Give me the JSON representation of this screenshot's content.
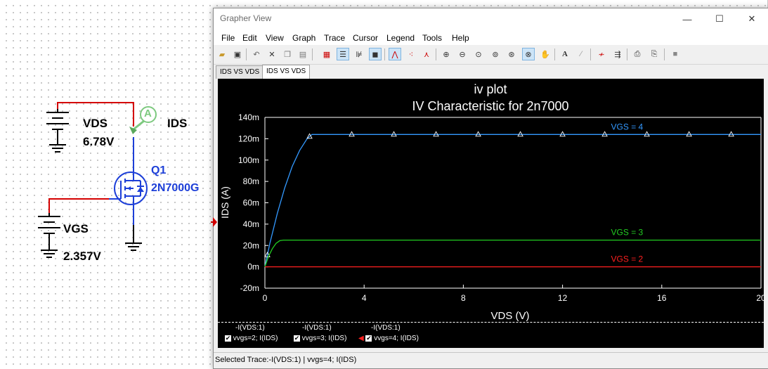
{
  "schematic": {
    "vds": {
      "name": "VDS",
      "value": "6.78V"
    },
    "vgs": {
      "name": "VGS",
      "value": "2.357V"
    },
    "ammeter": {
      "symbol": "A",
      "label": "IDS"
    },
    "transistor": {
      "ref": "Q1",
      "part": "2N7000G"
    },
    "colors": {
      "wire": "#d40000",
      "part": "#1d3fd8",
      "probe": "#7dc97f"
    }
  },
  "window": {
    "title": "Grapher View",
    "controls": {
      "minimize": "—",
      "maximize": "☐",
      "close": "✕"
    }
  },
  "menu": [
    "File",
    "Edit",
    "View",
    "Graph",
    "Trace",
    "Cursor",
    "Legend",
    "Tools",
    "Help"
  ],
  "toolbar_icons": [
    "open-icon",
    "save-icon",
    "undo-icon",
    "cut-icon",
    "copy-icon",
    "paste-icon",
    "grid-icon",
    "legend-icon",
    "bode-icon",
    "reverse-colors-icon",
    "cursor-icon",
    "data-point-icon",
    "data-marker-icon",
    "zoom-in-icon",
    "zoom-out-icon",
    "zoom-area-icon",
    "zoom-x-icon",
    "zoom-y-icon",
    "zoom-full-icon",
    "pan-icon",
    "text-icon",
    "format-icon",
    "overlay-icon",
    "export-icon",
    "print-icon",
    "print-preview-icon",
    "stop-icon"
  ],
  "tabs": [
    {
      "label": "IDS VS VDS"
    },
    {
      "label": "IDS VS VDS"
    }
  ],
  "chart_data": {
    "type": "line",
    "title": "iv plot",
    "subtitle": "IV Characteristic for 2n7000",
    "xlabel": "VDS (V)",
    "ylabel": "IDS (A)",
    "xlim": [
      0,
      20
    ],
    "ylim": [
      -0.02,
      0.14
    ],
    "x_ticks": [
      "0",
      "4",
      "8",
      "12",
      "16",
      "20"
    ],
    "y_ticks": [
      "140m",
      "120m",
      "100m",
      "80m",
      "60m",
      "40m",
      "20m",
      "0m",
      "-20m"
    ],
    "grid": false,
    "background": "#000000",
    "series": [
      {
        "name": "VGS = 4",
        "color": "#3399ff",
        "x": [
          0,
          0.2,
          0.5,
          0.8,
          1.1,
          1.4,
          1.7,
          1.9,
          2,
          20
        ],
        "y": [
          0,
          0.022,
          0.05,
          0.074,
          0.094,
          0.109,
          0.12,
          0.124,
          0.124,
          0.124
        ],
        "markers_x": [
          0.1,
          1.8,
          3.5,
          5.2,
          6.9,
          8.6,
          10.3,
          12.0,
          13.7,
          15.4,
          17.1,
          18.8
        ]
      },
      {
        "name": "VGS = 3",
        "color": "#22cc22",
        "x": [
          0,
          0.15,
          0.3,
          0.45,
          0.6,
          0.75,
          20
        ],
        "y": [
          0,
          0.01,
          0.017,
          0.022,
          0.0245,
          0.025,
          0.025
        ]
      },
      {
        "name": "VGS = 2",
        "color": "#ff2020",
        "x": [
          0,
          20
        ],
        "y": [
          0,
          0
        ]
      }
    ]
  },
  "legend": [
    {
      "top": "-I(VDS:1)",
      "bottom": "vvgs=2; I(IDS)"
    },
    {
      "top": "-I(VDS:1)",
      "bottom": "vvgs=3; I(IDS)"
    },
    {
      "top": "-I(VDS:1)",
      "bottom": "vvgs=4; I(IDS)"
    }
  ],
  "status": "Selected Trace:-I(VDS:1) | vvgs=4; I(IDS)"
}
